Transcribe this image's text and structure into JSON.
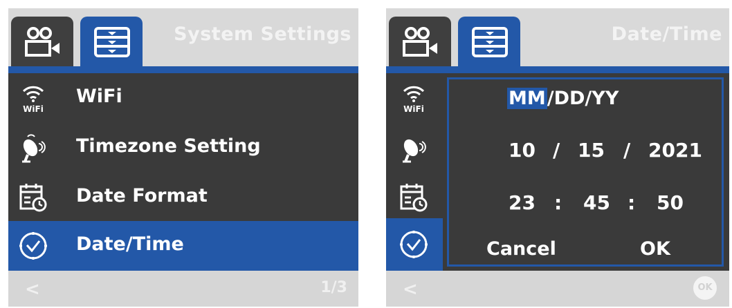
{
  "settings_screen": {
    "title": "System Settings",
    "tabs": [
      {
        "icon": "camera-icon"
      },
      {
        "icon": "settings-list-icon"
      }
    ],
    "menu": [
      {
        "label": "WiFi",
        "icon": "wifi-icon"
      },
      {
        "label": "Timezone Setting",
        "icon": "satellite-dish-icon"
      },
      {
        "label": "Date Format",
        "icon": "calendar-clock-icon"
      },
      {
        "label": "Date/Time",
        "icon": "clock-icon",
        "selected": true
      }
    ],
    "footer": {
      "back": "<",
      "page": "1/3"
    }
  },
  "datetime_screen": {
    "title": "Date/Time",
    "format": {
      "month": "MM",
      "rest": "/DD/YY"
    },
    "date": {
      "month": "10",
      "day": "15",
      "year": "2021",
      "separator": "/"
    },
    "time": {
      "hour": "23",
      "minute": "45",
      "second": "50",
      "separator": ":"
    },
    "buttons": {
      "cancel": "Cancel",
      "ok": "OK"
    },
    "footer": {
      "back": "<",
      "ok": "OK"
    }
  },
  "colors": {
    "accent": "#2358a8",
    "body": "#3a3a3a",
    "bar": "#d9d9d9"
  }
}
